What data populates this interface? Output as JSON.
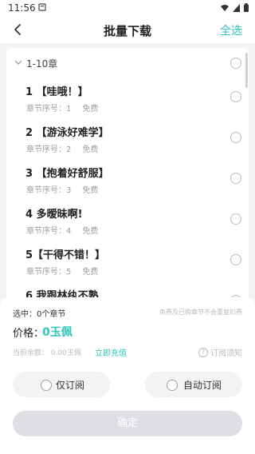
{
  "status_bar": {
    "time": "11:56"
  },
  "header": {
    "title": "批量下载",
    "select_all": "全选"
  },
  "group": {
    "label": "1-10章"
  },
  "chapters": [
    {
      "title": "1 【哇哦！】",
      "meta": "章节序号：1",
      "price": "免费"
    },
    {
      "title": "2 【游泳好难学】",
      "meta": "章节序号：2",
      "price": "免费"
    },
    {
      "title": "3 【抱着好舒服】",
      "meta": "章节序号：3",
      "price": "免费"
    },
    {
      "title": "4 多暧昧啊!",
      "meta": "章节序号：4",
      "price": "免费"
    },
    {
      "title": "5【干得不错！】",
      "meta": "章节序号：5",
      "price": "免费"
    },
    {
      "title": "6 我跟林纨不熟",
      "meta": "",
      "price": ""
    }
  ],
  "footer": {
    "selected": "选中：0个章节",
    "notice": "免费及已购章节不会重复扣费",
    "price_label": "价格：",
    "price_value": "0玉佩",
    "balance": "当前余额： 0.00玉佩",
    "recharge": "立即充值",
    "subscription_notice": "订阅须知",
    "option_only": "仅订阅",
    "option_auto": "自动订阅",
    "confirm": "确定"
  },
  "colors": {
    "accent": "#2fc5b8",
    "disabled": "#dedfe2",
    "background": "#f2f3f5"
  }
}
